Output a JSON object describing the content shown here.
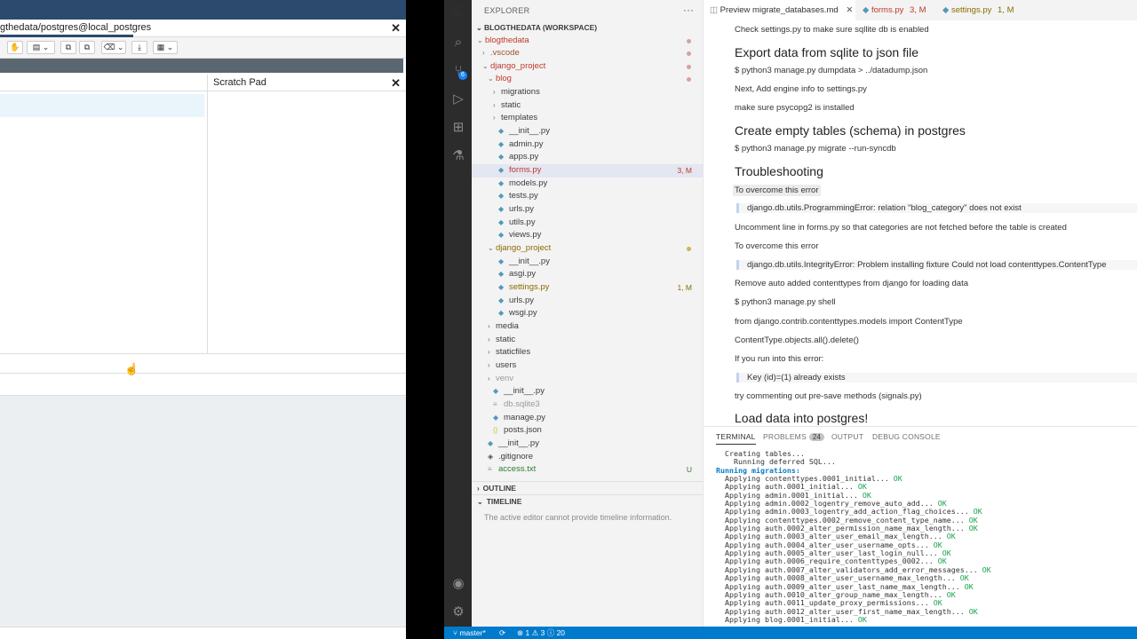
{
  "pgadmin": {
    "tab_title": "gthedata/postgres@local_postgres",
    "close_glyph": "✕",
    "scratch_pad": {
      "title": "Scratch Pad",
      "close_glyph": "✕"
    },
    "cursor_glyph": "☝"
  },
  "vscode": {
    "explorer": {
      "title": "EXPLORER",
      "more": "···",
      "workspace": "BLOGTHEDATA (WORKSPACE)",
      "tree": [
        {
          "label": "blogthedata",
          "depth": 0,
          "kind": "folder-open",
          "color": "#c0392b",
          "dot": "#d9a0a0"
        },
        {
          "label": ".vscode",
          "depth": 1,
          "kind": "folder",
          "color": "#a0522d",
          "dot": "#d9a0a0"
        },
        {
          "label": "django_project",
          "depth": 1,
          "kind": "folder-open",
          "color": "#c0392b",
          "dot": "#d9a0a0"
        },
        {
          "label": "blog",
          "depth": 2,
          "kind": "folder-open",
          "color": "#c0392b",
          "dot": "#d9a0a0"
        },
        {
          "label": "migrations",
          "depth": 3,
          "kind": "folder"
        },
        {
          "label": "static",
          "depth": 3,
          "kind": "folder"
        },
        {
          "label": "templates",
          "depth": 3,
          "kind": "folder"
        },
        {
          "label": "__init__.py",
          "depth": 3,
          "kind": "py"
        },
        {
          "label": "admin.py",
          "depth": 3,
          "kind": "py"
        },
        {
          "label": "apps.py",
          "depth": 3,
          "kind": "py"
        },
        {
          "label": "forms.py",
          "depth": 3,
          "kind": "py",
          "color": "#c0392b",
          "badge": "3, M",
          "badge_color": "#c0392b",
          "selected": true
        },
        {
          "label": "models.py",
          "depth": 3,
          "kind": "py"
        },
        {
          "label": "tests.py",
          "depth": 3,
          "kind": "py"
        },
        {
          "label": "urls.py",
          "depth": 3,
          "kind": "py"
        },
        {
          "label": "utils.py",
          "depth": 3,
          "kind": "py"
        },
        {
          "label": "views.py",
          "depth": 3,
          "kind": "py"
        },
        {
          "label": "django_project",
          "depth": 2,
          "kind": "folder-open",
          "color": "#8b6c00",
          "dot": "#c9b458"
        },
        {
          "label": "__init__.py",
          "depth": 3,
          "kind": "py"
        },
        {
          "label": "asgi.py",
          "depth": 3,
          "kind": "py"
        },
        {
          "label": "settings.py",
          "depth": 3,
          "kind": "py",
          "color": "#8b6c00",
          "badge": "1, M",
          "badge_color": "#8b6c00"
        },
        {
          "label": "urls.py",
          "depth": 3,
          "kind": "py"
        },
        {
          "label": "wsgi.py",
          "depth": 3,
          "kind": "py"
        },
        {
          "label": "media",
          "depth": 2,
          "kind": "folder"
        },
        {
          "label": "static",
          "depth": 2,
          "kind": "folder"
        },
        {
          "label": "staticfiles",
          "depth": 2,
          "kind": "folder"
        },
        {
          "label": "users",
          "depth": 2,
          "kind": "folder"
        },
        {
          "label": "venv",
          "depth": 2,
          "kind": "folder",
          "color": "#9a9a9a"
        },
        {
          "label": "__init__.py",
          "depth": 2,
          "kind": "py"
        },
        {
          "label": "db.sqlite3",
          "depth": 2,
          "kind": "txt",
          "color": "#9a9a9a"
        },
        {
          "label": "manage.py",
          "depth": 2,
          "kind": "py"
        },
        {
          "label": "posts.json",
          "depth": 2,
          "kind": "json"
        },
        {
          "label": "__init__.py",
          "depth": 1,
          "kind": "py"
        },
        {
          "label": ".gitignore",
          "depth": 1,
          "kind": "git"
        },
        {
          "label": "access.txt",
          "depth": 1,
          "kind": "txt",
          "color": "#2e7d32",
          "badge": "U",
          "badge_color": "#2e7d32"
        }
      ],
      "outline": "OUTLINE",
      "timeline": "TIMELINE",
      "timeline_msg": "The active editor cannot provide timeline information."
    },
    "tabs": [
      {
        "label": "Preview migrate_databases.md",
        "close": "✕",
        "active": true
      },
      {
        "label": "forms.py",
        "status": "3, M",
        "color": "#c0392b"
      },
      {
        "label": "settings.py",
        "status": "1, M",
        "color": "#8b6c00"
      }
    ],
    "preview": [
      {
        "type": "p",
        "text": "Check settings.py to make sure sqllite db is enabled"
      },
      {
        "type": "h",
        "text": "Export data from sqlite to json file"
      },
      {
        "type": "p",
        "text": "$ python3 manage.py dumpdata > ../datadump.json"
      },
      {
        "type": "p",
        "text": "Next, Add engine info to settings.py"
      },
      {
        "type": "p",
        "text": "make sure psycopg2 is installed"
      },
      {
        "type": "h",
        "text": "Create empty tables (schema) in postgres"
      },
      {
        "type": "p",
        "text": "$ python3 manage.py migrate --run-syncdb"
      },
      {
        "type": "h",
        "text": "Troubleshooting"
      },
      {
        "type": "hl",
        "text": "To overcome this error"
      },
      {
        "type": "bq",
        "text": "django.db.utils.ProgrammingError: relation \"blog_category\" does not exist"
      },
      {
        "type": "p",
        "text": "Uncomment line in forms.py so that categories are not fetched before the table is created"
      },
      {
        "type": "p",
        "text": "To overcome this error"
      },
      {
        "type": "bq",
        "text": "django.db.utils.IntegrityError: Problem installing fixture Could not load contenttypes.ContentType"
      },
      {
        "type": "p",
        "text": "Remove auto added contenttypes from django for loading data"
      },
      {
        "type": "p",
        "text": "$ python3 manage.py shell"
      },
      {
        "type": "p",
        "text": "from django.contrib.contenttypes.models import ContentType"
      },
      {
        "type": "p",
        "text": "ContentType.objects.all().delete()"
      },
      {
        "type": "p",
        "text": "If you run into this error:"
      },
      {
        "type": "bq",
        "text": "Key (id)=(1) already exists"
      },
      {
        "type": "p",
        "text": "try commenting out pre-save methods (signals.py)"
      },
      {
        "type": "h",
        "text": "Load data into postgres!"
      }
    ],
    "panel": {
      "tabs": [
        {
          "label": "TERMINAL",
          "active": true
        },
        {
          "label": "PROBLEMS",
          "badge": "24"
        },
        {
          "label": "OUTPUT"
        },
        {
          "label": "DEBUG CONSOLE"
        }
      ],
      "terminal_lines": [
        {
          "text": "  Creating tables..."
        },
        {
          "text": "    Running deferred SQL..."
        },
        {
          "text": "Running migrations:",
          "style": "mig"
        },
        {
          "text": "  Applying contenttypes.0001_initial...",
          "ok": " OK"
        },
        {
          "text": "  Applying auth.0001_initial...",
          "ok": " OK"
        },
        {
          "text": "  Applying admin.0001_initial...",
          "ok": " OK"
        },
        {
          "text": "  Applying admin.0002_logentry_remove_auto_add...",
          "ok": " OK"
        },
        {
          "text": "  Applying admin.0003_logentry_add_action_flag_choices...",
          "ok": " OK"
        },
        {
          "text": "  Applying contenttypes.0002_remove_content_type_name...",
          "ok": " OK"
        },
        {
          "text": "  Applying auth.0002_alter_permission_name_max_length...",
          "ok": " OK"
        },
        {
          "text": "  Applying auth.0003_alter_user_email_max_length...",
          "ok": " OK"
        },
        {
          "text": "  Applying auth.0004_alter_user_username_opts...",
          "ok": " OK"
        },
        {
          "text": "  Applying auth.0005_alter_user_last_login_null...",
          "ok": " OK"
        },
        {
          "text": "  Applying auth.0006_require_contenttypes_0002...",
          "ok": " OK"
        },
        {
          "text": "  Applying auth.0007_alter_validators_add_error_messages...",
          "ok": " OK"
        },
        {
          "text": "  Applying auth.0008_alter_user_username_max_length...",
          "ok": " OK"
        },
        {
          "text": "  Applying auth.0009_alter_user_last_name_max_length...",
          "ok": " OK"
        },
        {
          "text": "  Applying auth.0010_alter_group_name_max_length...",
          "ok": " OK"
        },
        {
          "text": "  Applying auth.0011_update_proxy_permissions...",
          "ok": " OK"
        },
        {
          "text": "  Applying auth.0012_alter_user_first_name_max_length...",
          "ok": " OK"
        },
        {
          "text": "  Applying blog.0001_initial...",
          "ok": " OK"
        }
      ]
    },
    "statusbar": {
      "branch": "master*",
      "sync_icon": "⟳",
      "errors": "1",
      "warnings": "3",
      "infos": "20"
    }
  }
}
